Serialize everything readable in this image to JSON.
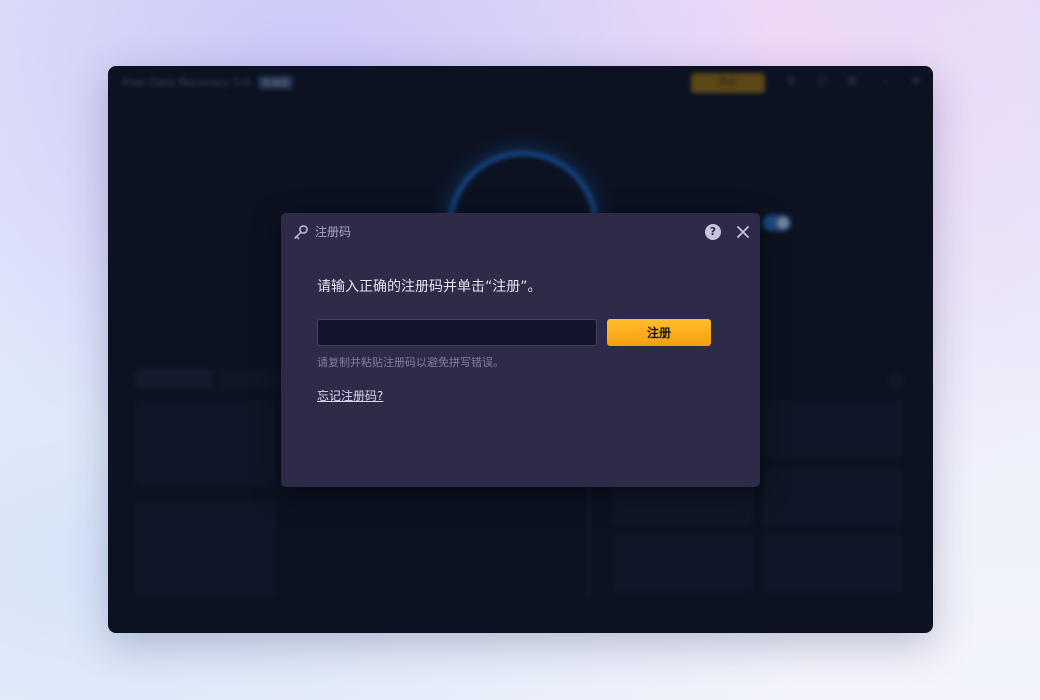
{
  "background_app": {
    "title": "Free Data Recovery 5.0",
    "version_badge": "标准版",
    "upgrade_label": "购买",
    "accent_color": "#1b6fd6"
  },
  "dialog": {
    "title": "注册码",
    "title_icon": "key-icon",
    "help_icon": "help-icon",
    "close_icon": "close-icon",
    "instruction": "请输入正确的注册码并单击“注册”。",
    "code_input": {
      "value": "",
      "placeholder": ""
    },
    "register_label": "注册",
    "register_color": "#f8a919",
    "hint": "请复制并粘贴注册码以避免拼写错误。",
    "forgot_link": "忘记注册码?"
  }
}
